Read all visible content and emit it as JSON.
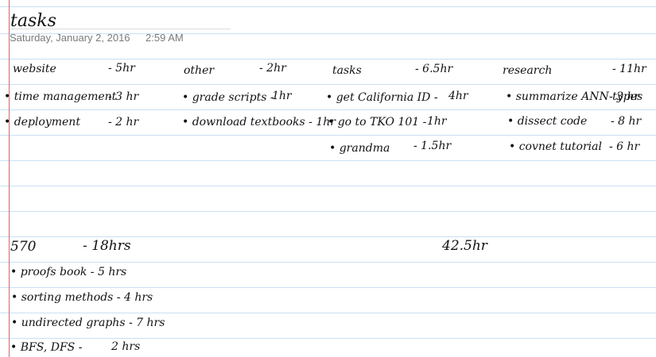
{
  "page": {
    "title": "tasks",
    "date": "Saturday, January 2, 2016",
    "time": "2:59 AM"
  },
  "columns": [
    {
      "heading": "website",
      "total": "- 5hr",
      "items": [
        {
          "text": "time management",
          "hours": "- 3 hr"
        },
        {
          "text": "deployment",
          "hours": "- 2 hr"
        }
      ]
    },
    {
      "heading": "other",
      "total": "- 2hr",
      "items": [
        {
          "text": "grade scripts -",
          "hours": "1hr"
        },
        {
          "text": "download textbooks - 1hr",
          "hours": ""
        }
      ]
    },
    {
      "heading": "tasks",
      "total": "- 6.5hr",
      "items": [
        {
          "text": "get California ID -",
          "hours": "4hr"
        },
        {
          "text": "go to TKO 101 -",
          "hours": "1hr"
        },
        {
          "text": "grandma",
          "hours": "- 1.5hr"
        }
      ]
    },
    {
      "heading": "research",
      "total": "- 11hr",
      "items": [
        {
          "text": "summarize ANN types",
          "hours": "- 3 hr"
        },
        {
          "text": "dissect code",
          "hours": "- 8 hr"
        },
        {
          "text": "covnet tutorial",
          "hours": "- 6 hr"
        }
      ]
    }
  ],
  "course": {
    "heading": "570",
    "total": "- 18hrs",
    "items": [
      {
        "text": "proofs book - 5 hrs"
      },
      {
        "text": "sorting methods - 4 hrs"
      },
      {
        "text": "undirected graphs - 7 hrs"
      },
      {
        "text": "BFS, DFS -",
        "hours": "2 hrs"
      }
    ]
  },
  "grand_total": "42.5hr",
  "colors": {
    "rule": "#c9dff2",
    "margin": "#e06070",
    "meta_text": "#7a7a7a",
    "ink": "#111111"
  }
}
